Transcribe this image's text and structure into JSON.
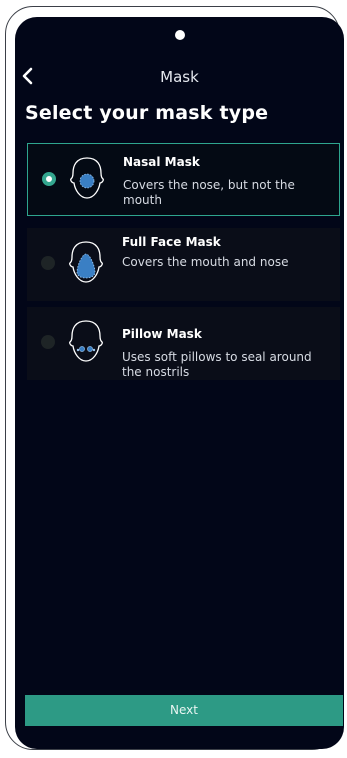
{
  "header": {
    "title": "Mask"
  },
  "page": {
    "title": "Select your mask type"
  },
  "options": [
    {
      "title": "Nasal Mask",
      "description": "Covers the nose, but not the mouth",
      "selected": true
    },
    {
      "title": "Full Face Mask",
      "description": "Covers the mouth and nose",
      "selected": false
    },
    {
      "title": "Pillow Mask",
      "description": "Uses soft pillows to seal around the nostrils",
      "selected": false
    }
  ],
  "footer": {
    "next_label": "Next"
  },
  "colors": {
    "accent": "#2ea58e",
    "background": "#020618",
    "mask_fill": "#3a7fc4"
  },
  "icons": {
    "back": "chevron-left-icon",
    "face": "face-outline-icon"
  }
}
